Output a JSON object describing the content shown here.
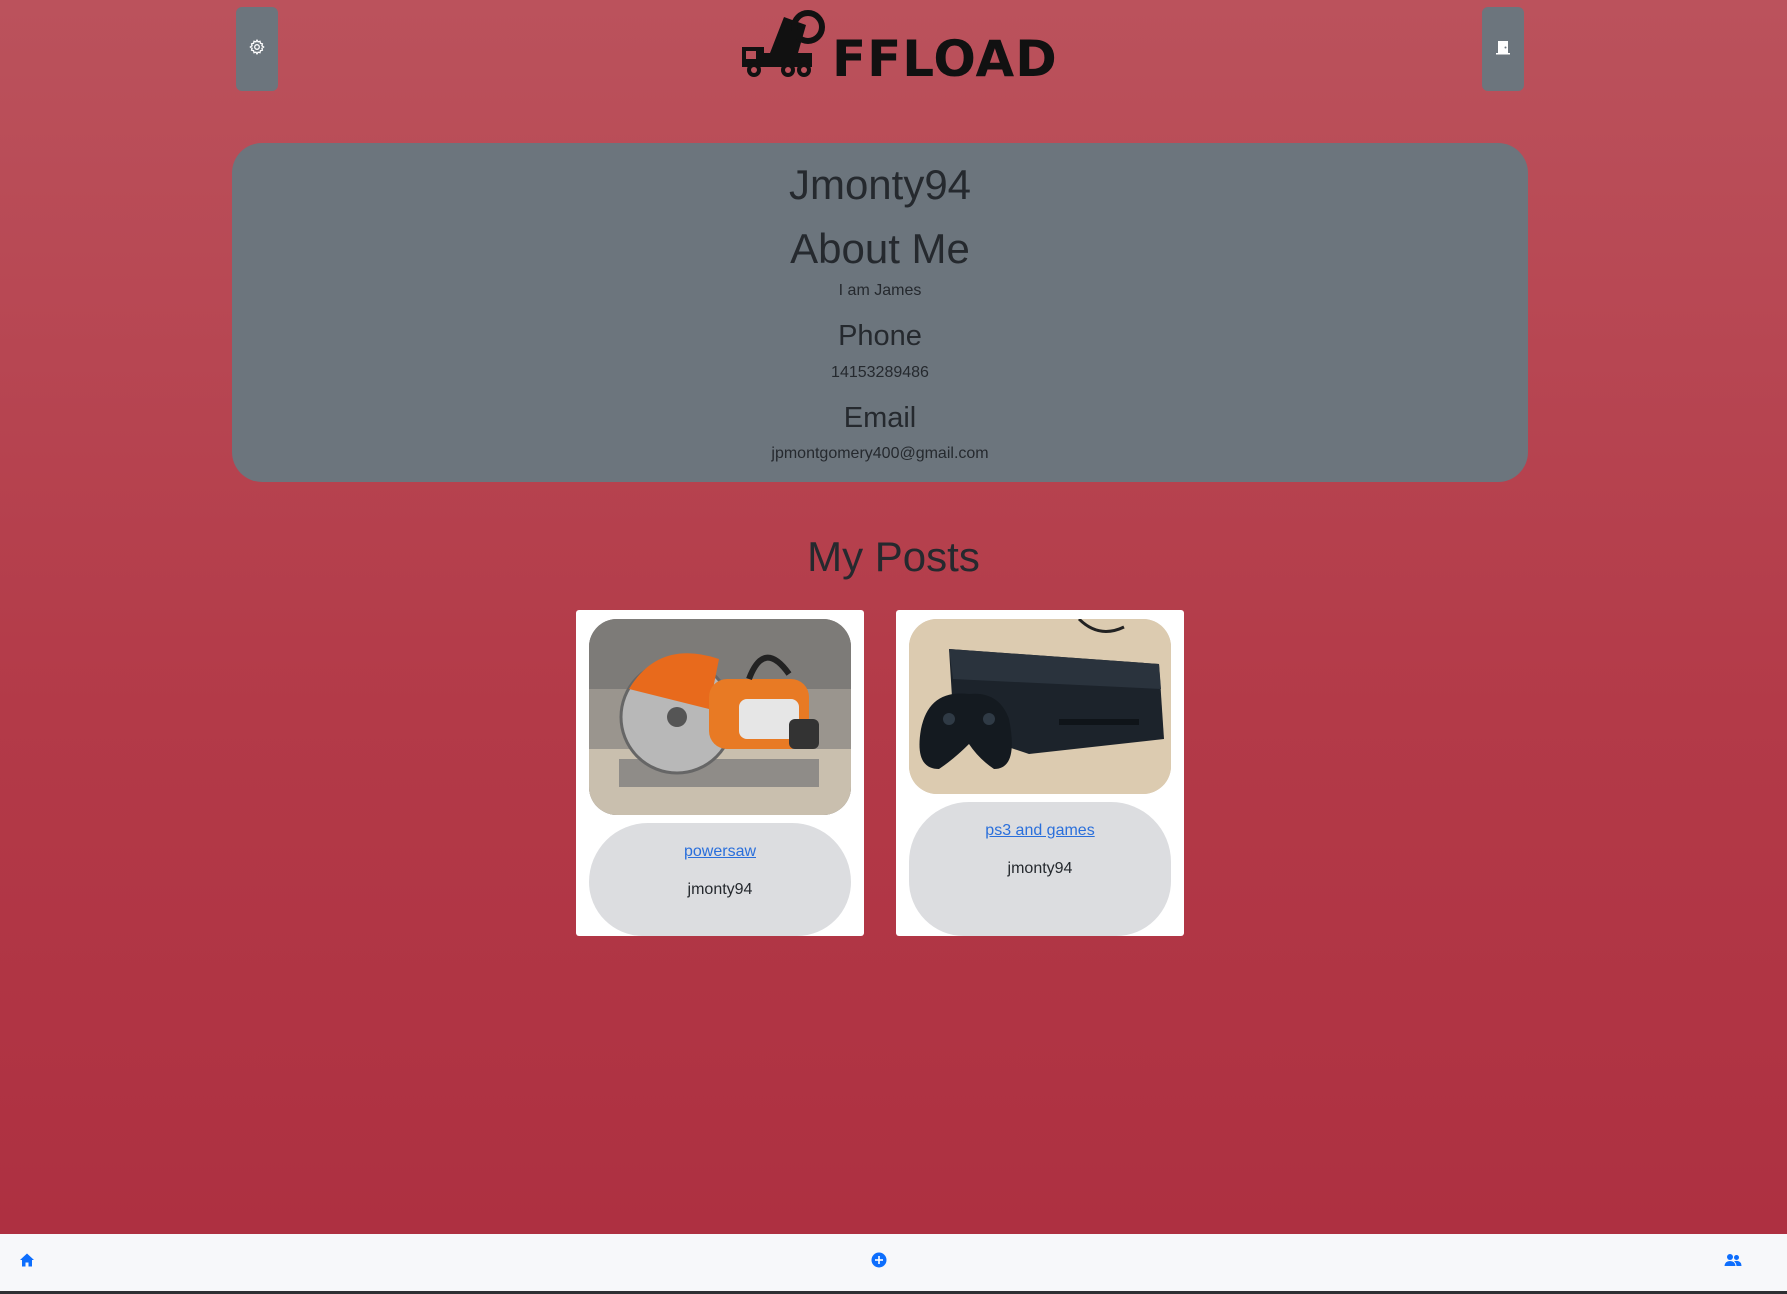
{
  "app": {
    "logo_text": "FFLOAD"
  },
  "header": {
    "settings_icon": "gear-icon",
    "logout_icon": "door-icon"
  },
  "profile": {
    "username": "Jmonty94",
    "about_heading": "About Me",
    "about_text": "I am James",
    "phone_heading": "Phone",
    "phone": "14153289486",
    "email_heading": "Email",
    "email": "jpmontgomery400@gmail.com"
  },
  "posts": {
    "heading": "My Posts",
    "items": [
      {
        "title": "powersaw",
        "author": "jmonty94",
        "image_icon": "power-saw-image"
      },
      {
        "title": "ps3 and games",
        "author": "jmonty94",
        "image_icon": "ps3-console-image"
      }
    ]
  },
  "bottom_nav": {
    "home_icon": "home-icon",
    "add_icon": "plus-circle-icon",
    "users_icon": "users-icon"
  },
  "colors": {
    "background_top": "#bb525c",
    "background_bottom": "#ad2f40",
    "card": "#6c757d",
    "link": "#2a6fdb",
    "nav_icon": "#0d6efd"
  }
}
